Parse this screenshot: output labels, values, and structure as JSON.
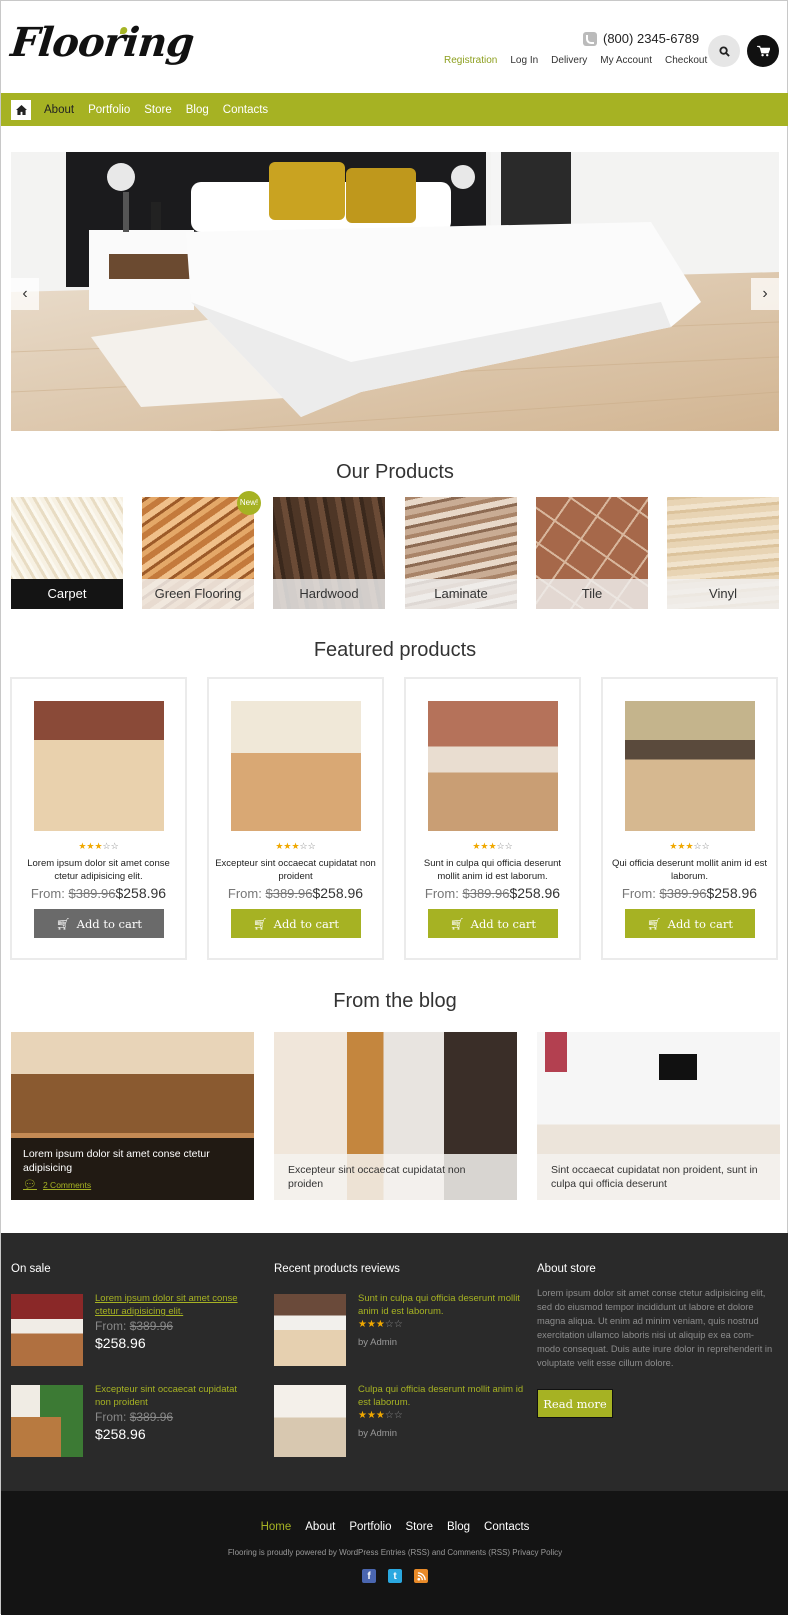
{
  "header": {
    "logo": "Flooring",
    "phone": "(800) 2345-6789",
    "top_links": [
      "Registration",
      "Log In",
      "Delivery",
      "My Account",
      "Checkout"
    ]
  },
  "nav": {
    "items": [
      "About",
      "Portfolio",
      "Store",
      "Blog",
      "Contacts"
    ],
    "active": "About"
  },
  "slider": {
    "prev_label": "‹",
    "next_label": "›"
  },
  "our_products": {
    "title": "Our Products",
    "new_badge": "New!",
    "categories": [
      "Carpet",
      "Green Flooring",
      "Hardwood",
      "Laminate",
      "Tile",
      "Vinyl"
    ]
  },
  "featured": {
    "title": "Featured products",
    "products": [
      {
        "desc": "Lorem ipsum dolor sit amet conse ctetur adipisicing elit.",
        "from": "From:",
        "old_price": "$389.96",
        "price": "$258.96",
        "button": "Add to cart",
        "rating": 3
      },
      {
        "desc": "Excepteur sint occaecat cupidatat non proident",
        "from": "From:",
        "old_price": "$389.96",
        "price": "$258.96",
        "button": "Add to cart",
        "rating": 3
      },
      {
        "desc": "Sunt in culpa qui officia deserunt mollit anim id est laborum.",
        "from": "From:",
        "old_price": "$389.96",
        "price": "$258.96",
        "button": "Add to cart",
        "rating": 3
      },
      {
        "desc": "Qui officia deserunt mollit anim id est laborum.",
        "from": "From:",
        "old_price": "$389.96",
        "price": "$258.96",
        "button": "Add to cart",
        "rating": 3
      }
    ]
  },
  "blog": {
    "title": "From the blog",
    "posts": [
      {
        "caption": "Lorem ipsum dolor sit amet conse ctetur adipisicing",
        "comments": "2 Comments"
      },
      {
        "caption": "Excepteur sint occaecat cupidatat non proiden"
      },
      {
        "caption": "Sint occaecat cupidatat non proident, sunt in culpa qui officia deserunt"
      }
    ]
  },
  "widgets": {
    "on_sale": {
      "title": "On sale",
      "items": [
        {
          "title": "Lorem ipsum dolor sit amet conse ctetur adipisicing elit.",
          "from": "From:",
          "old_price": "$389.96",
          "price": "$258.96"
        },
        {
          "title": "Excepteur sint occaecat cupidatat non proident",
          "from": "From:",
          "old_price": "$389.96",
          "price": "$258.96"
        }
      ]
    },
    "reviews": {
      "title": "Recent products reviews",
      "items": [
        {
          "title": "Sunt in culpa qui officia deserunt mollit anim id est laborum.",
          "rating": 3,
          "by": "by Admin"
        },
        {
          "title": "Culpa qui officia deserunt mollit anim id est laborum.",
          "rating": 3,
          "by": "by Admin"
        }
      ]
    },
    "about": {
      "title": "About store",
      "text": "Lorem ipsum dolor sit amet conse ctetur adipisicing elit, sed do eiusmod tempor incididunt ut labore et dolore magna aliqua. Ut enim ad minim veniam, quis nostrud exercitation ullamco laboris nisi ut aliquip ex ea com-modo consequat. Duis aute irure dolor in reprehenderit in voluptate velit esse cillum dolore.",
      "button": "Read more"
    }
  },
  "footer": {
    "nav": [
      "Home",
      "About",
      "Portfolio",
      "Store",
      "Blog",
      "Contacts"
    ],
    "copyright": "Flooring is proudly powered by WordPress Entries (RSS) and Comments (RSS) Privacy Policy",
    "social": [
      "facebook-icon",
      "twitter-icon",
      "rss-icon"
    ]
  },
  "colors": {
    "accent": "#a6b223",
    "dark_footer": "#141414",
    "widgets_bg": "#2a2a2a",
    "star": "#f0a800"
  }
}
